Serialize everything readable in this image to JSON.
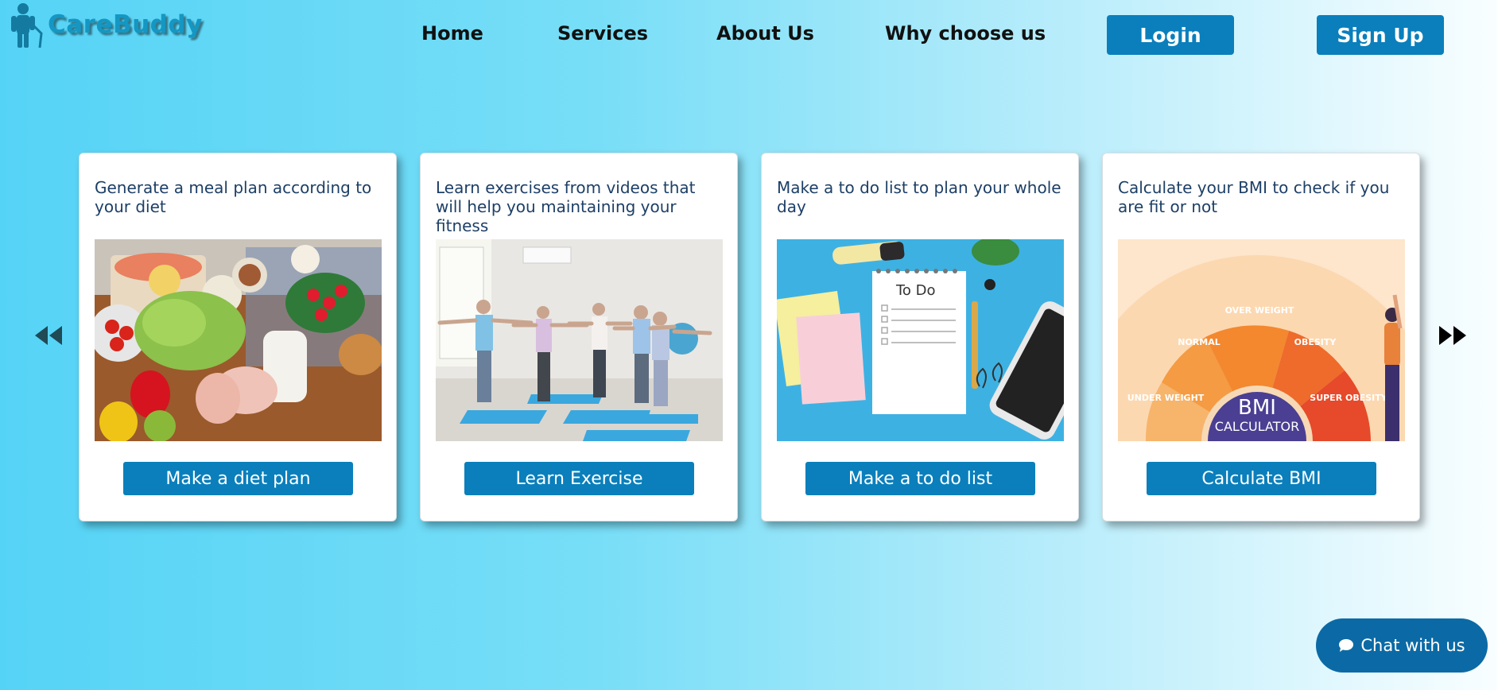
{
  "brand": {
    "name": "CareBuddy",
    "color": "#1497c3"
  },
  "nav": {
    "links": [
      "Home",
      "Services",
      "About Us",
      "Why choose us"
    ],
    "login_label": "Login",
    "signup_label": "Sign Up"
  },
  "carousel": {
    "prev_icon": "double-left-arrow-icon",
    "next_icon": "double-right-arrow-icon",
    "cards": [
      {
        "text": "Generate a meal plan according to your diet",
        "image": "food-ingredients-image",
        "button": "Make a diet plan"
      },
      {
        "text": "Learn exercises from videos that will help you maintaining your fitness",
        "image": "seniors-exercising-image",
        "button": "Learn Exercise"
      },
      {
        "text": "Make a to do list to plan your whole day",
        "image": "todo-notepad-image",
        "button": "Make a to do list"
      },
      {
        "text": "Calculate your BMI to check if you are fit or not",
        "image": "bmi-calculator-image",
        "button": "Calculate BMI",
        "image_text": {
          "segments": [
            "UNDER WEIGHT",
            "NORMAL",
            "OVER WEIGHT",
            "OBESITY",
            "SUPER OBESITY"
          ],
          "title": "BMI",
          "subtitle": "CALCULATOR",
          "notepad_title": "To Do"
        }
      }
    ]
  },
  "chat": {
    "label": "Chat with us",
    "icon": "chat-bubble-icon"
  },
  "colors": {
    "accent": "#0a7fbc",
    "chat": "#0b6aa5",
    "card_text": "#1d3f66"
  }
}
